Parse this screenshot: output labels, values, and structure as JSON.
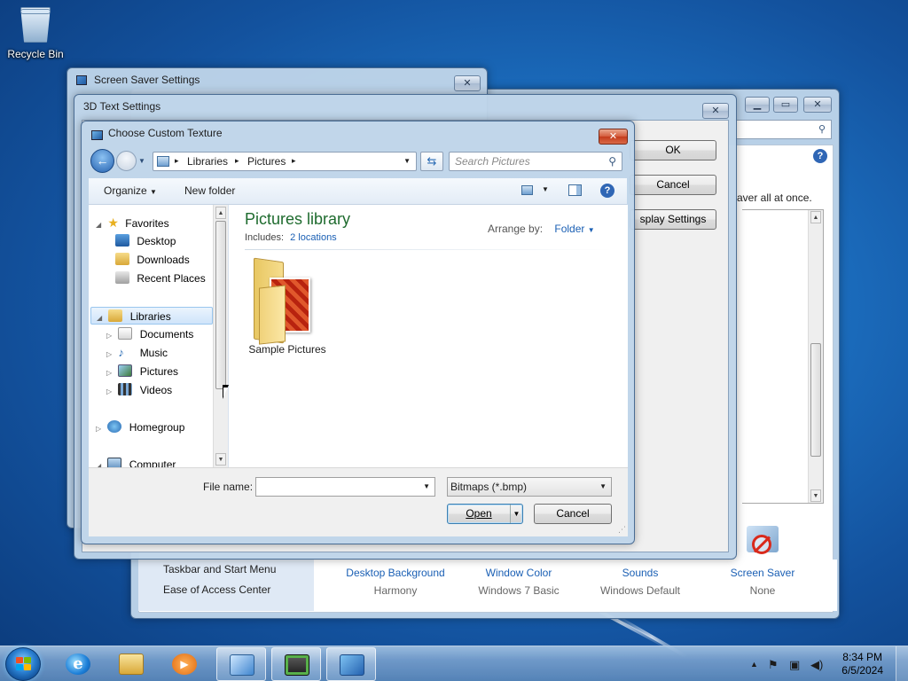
{
  "desktop": {
    "recycle_bin_label": "Recycle Bin"
  },
  "personalization_window": {
    "search_placeholder": "",
    "description_fragment": "aver all at once.",
    "sidebar_links": [
      "Taskbar and Start Menu",
      "Ease of Access Center"
    ],
    "theme_items": [
      {
        "title": "Desktop Background",
        "subtitle": "Harmony"
      },
      {
        "title": "Window Color",
        "subtitle": "Windows 7 Basic"
      },
      {
        "title": "Sounds",
        "subtitle": "Windows Default"
      },
      {
        "title": "Screen Saver",
        "subtitle": "None"
      }
    ]
  },
  "screen_saver_window": {
    "title": "Screen Saver Settings"
  },
  "text3d_window": {
    "title": "3D Text Settings",
    "ok_label": "OK",
    "cancel_label": "Cancel",
    "display_settings_label": "splay Settings"
  },
  "texture_dialog": {
    "title": "Choose Custom Texture",
    "address": {
      "crumbs": [
        "Libraries",
        "Pictures"
      ]
    },
    "search_placeholder": "Search Pictures",
    "toolbar": {
      "organize_label": "Organize",
      "new_folder_label": "New folder"
    },
    "nav": {
      "favorites_label": "Favorites",
      "favorites_items": [
        "Desktop",
        "Downloads",
        "Recent Places"
      ],
      "libraries_label": "Libraries",
      "libraries_items": [
        "Documents",
        "Music",
        "Pictures",
        "Videos"
      ],
      "homegroup_label": "Homegroup",
      "computer_label": "Computer"
    },
    "library_title": "Pictures library",
    "includes_label": "Includes:",
    "includes_link": "2 locations",
    "arrange_by_label": "Arrange by:",
    "arrange_by_value": "Folder",
    "folder_item": "Sample Pictures",
    "file_name_label": "File name:",
    "file_name_value": "",
    "file_type_value": "Bitmaps (*.bmp)",
    "open_label": "Open",
    "cancel_label": "Cancel"
  },
  "taskbar": {
    "time": "8:34 PM",
    "date": "6/5/2024"
  }
}
